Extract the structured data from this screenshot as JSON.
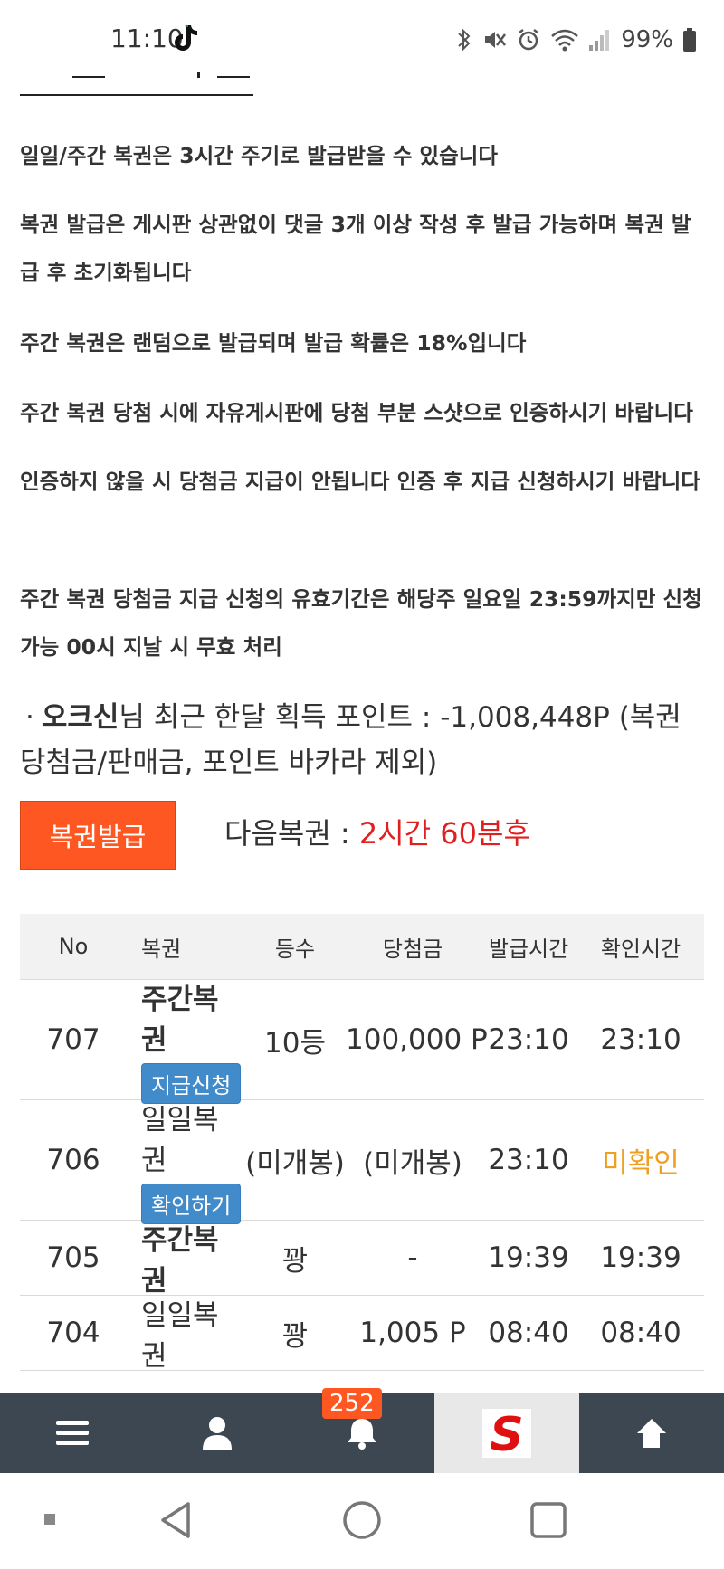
{
  "status_bar": {
    "time": "11:10",
    "battery": "99%",
    "icons": [
      "tiktok-icon",
      "bluetooth-icon",
      "mute-icon",
      "alarm-icon",
      "wifi-icon",
      "signal-icon",
      "battery-icon"
    ]
  },
  "notices": [
    "일일/주간 복권은 3시간 주기로 발급받을 수 있습니다",
    "복권 발급은 게시판 상관없이 댓글 3개 이상 작성 후 발급 가능하며 복권 발급 후 초기화됩니다",
    "주간 복권은 랜덤으로 발급되며 발급 확률은 18%입니다",
    "주간 복권 당첨 시에 자유게시판에 당첨 부분 스샷으로 인증하시기 바랍니다",
    "인증하지 않을 시 당첨금 지급이 안됩니다 인증 후 지급 신청하시기 바랍니다",
    "주간 복권 당첨금 지급 신청의 유효기간은 해당주 일요일 23:59까지만 신청 가능 00시 지날 시 무효 처리"
  ],
  "points": {
    "bullet": "·",
    "username": "오크신",
    "text": "님 최근 한달 획득 포인트 : -1,008,448P (복권 당첨금/판매금, 포인트 바카라 제외)"
  },
  "issue_button": "복권발급",
  "next_lottery": {
    "label": "다음복권 : ",
    "value": "2시간 60분후"
  },
  "table": {
    "headers": [
      "No",
      "복권",
      "등수",
      "당첨금",
      "발급시간",
      "확인시간"
    ],
    "rows": [
      {
        "no": "707",
        "ticket": "주간복권",
        "action": "지급신청",
        "rank": "10등",
        "prize": "100,000 P",
        "issued": "23:10",
        "checked": "23:10"
      },
      {
        "no": "706",
        "ticket": "일일복권",
        "action": "확인하기",
        "rank": "(미개봉)",
        "prize": "(미개봉)",
        "issued": "23:10",
        "checked": "미확인"
      },
      {
        "no": "705",
        "ticket": "주간복권",
        "rank": "꽝",
        "prize": "-",
        "issued": "19:39",
        "checked": "19:39"
      },
      {
        "no": "704",
        "ticket": "일일복권",
        "rank": "꽝",
        "prize": "1,005 P",
        "issued": "08:40",
        "checked": "08:40"
      }
    ]
  },
  "app_bar": {
    "notification_count": "252",
    "logo_letter": "S",
    "icons": [
      "menu-icon",
      "user-icon",
      "bell-icon",
      "site-logo",
      "arrow-up-icon"
    ]
  },
  "colors": {
    "accent": "#ff5722",
    "tag_blue": "#428bca",
    "red": "#e02020",
    "orange": "#f0a020",
    "appbar": "#3d4752"
  }
}
